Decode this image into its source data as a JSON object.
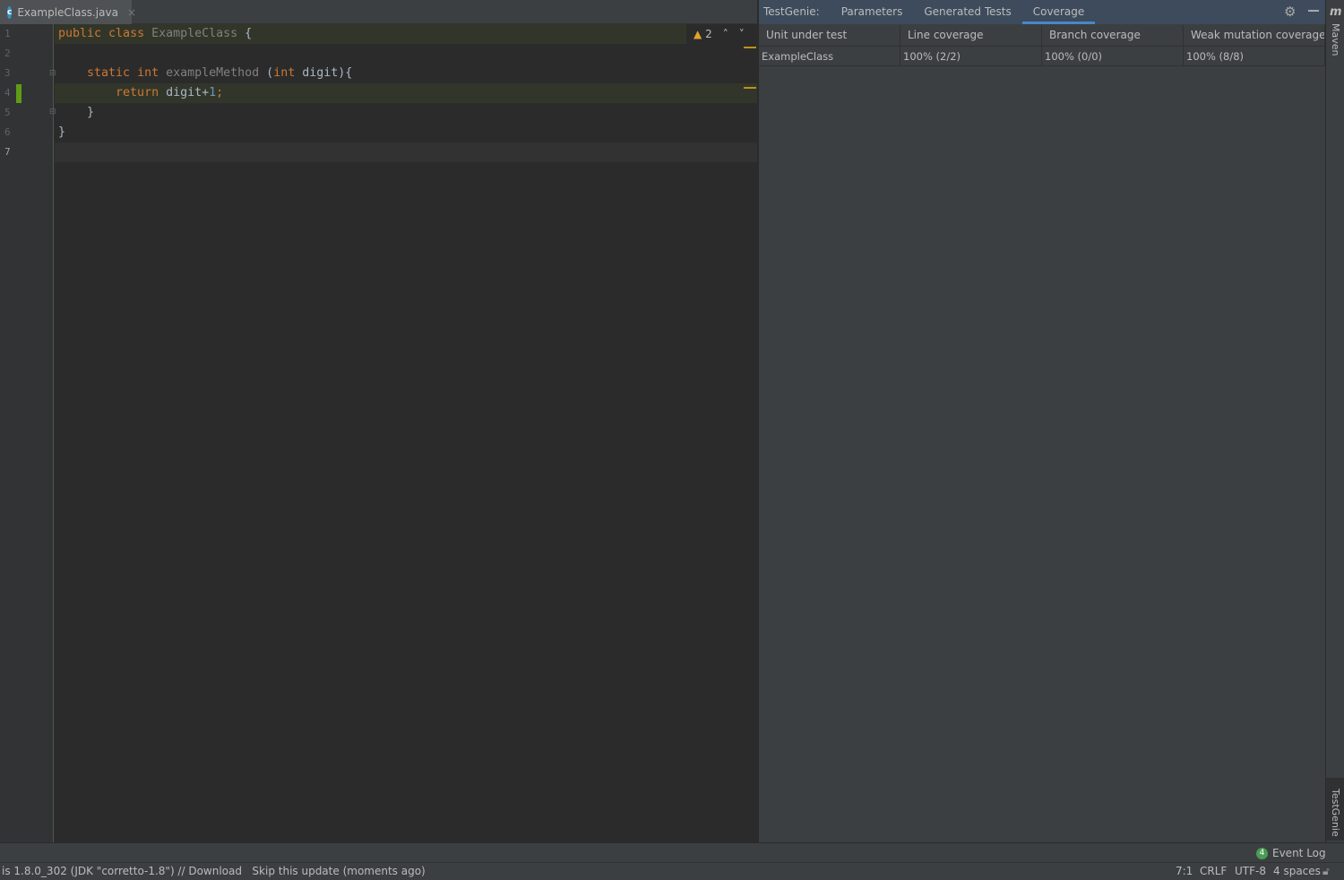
{
  "editor": {
    "tab": {
      "label": "ExampleClass.java",
      "icon": "class-c-icon"
    },
    "line_numbers": [
      "1",
      "2",
      "3",
      "4",
      "5",
      "6",
      "7"
    ],
    "lines": [
      [
        {
          "t": "public ",
          "k": "kw"
        },
        {
          "t": "class ",
          "k": "kw"
        },
        {
          "t": "ExampleClass ",
          "k": "cls"
        },
        {
          "t": "{",
          "k": "id"
        }
      ],
      [],
      [
        {
          "t": "    static ",
          "k": "kw"
        },
        {
          "t": "int ",
          "k": "kw"
        },
        {
          "t": "exampleMethod ",
          "k": "fn"
        },
        {
          "t": "(",
          "k": "id"
        },
        {
          "t": "int ",
          "k": "kw"
        },
        {
          "t": "digit){",
          "k": "id"
        }
      ],
      [
        {
          "t": "        return ",
          "k": "kw"
        },
        {
          "t": "digit+",
          "k": "id"
        },
        {
          "t": "1",
          "k": "num"
        },
        {
          "t": ";",
          "k": "kw"
        }
      ],
      [
        {
          "t": "    }",
          "k": "id"
        }
      ],
      [
        {
          "t": "}",
          "k": "id"
        }
      ],
      []
    ],
    "warning_count": "2",
    "colors": {
      "keyword": "#cc7832",
      "identifier": "#a9b7c6",
      "number": "#6897bb",
      "covered_marker": "#5e9c18"
    }
  },
  "panel": {
    "tabs": [
      {
        "label": "TestGenie:"
      },
      {
        "label": "Parameters"
      },
      {
        "label": "Generated Tests"
      },
      {
        "label": "Coverage",
        "active": true
      }
    ],
    "table": {
      "headers": [
        "Unit under test",
        "Line coverage",
        "Branch coverage",
        "Weak mutation coverage"
      ],
      "rows": [
        [
          "ExampleClass",
          "100% (2/2)",
          "100% (0/0)",
          "100% (8/8)"
        ]
      ]
    }
  },
  "right_stripe": {
    "maven": "Maven",
    "testgenie": "TestGenie"
  },
  "event_log": {
    "count": "4",
    "label": "Event Log"
  },
  "status": {
    "message": "is 1.8.0_302 (JDK \"corretto-1.8\") // Download   Skip this update (moments ago)",
    "position": "7:1",
    "line_sep": "CRLF",
    "encoding": "UTF-8",
    "indent": "4 spaces"
  }
}
